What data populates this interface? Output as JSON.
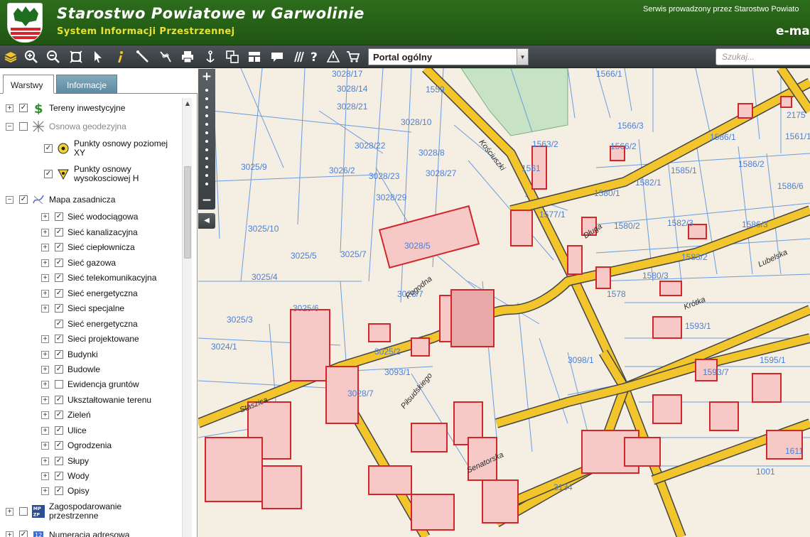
{
  "header": {
    "title": "Starostwo Powiatowe w Garwolinie",
    "subtitle": "System Informacji Przestrzennej",
    "service_text": "Serwis prowadzony przez Starostwo Powiato",
    "brand": "e-ma",
    "colors": {
      "bar": "#2d6d1c",
      "subtitle": "#e9e230"
    }
  },
  "toolbar": {
    "tools": [
      "layers-icon",
      "zoom-in-icon",
      "zoom-out-icon",
      "zoom-extent-icon",
      "pointer-icon",
      "info-icon",
      "measure-distance-icon",
      "measure-path-icon",
      "print-icon",
      "anchor-icon",
      "copy-icon",
      "layout-icon",
      "comment-icon",
      "hatch-icon",
      "help-icon",
      "warning-icon",
      "cart-icon"
    ],
    "portal_value": "Portal ogólny",
    "search_placeholder": "Szukaj..."
  },
  "panel": {
    "tabs": [
      "Warstwy",
      "Informacje"
    ],
    "layers": [
      {
        "label": "Tereny inwestycyjne",
        "level": 0,
        "checked": true,
        "expand": "+",
        "icon": "dollar-icon"
      },
      {
        "label": "Osnowa geodezyjna",
        "level": 0,
        "checked": false,
        "expand": "−",
        "icon": "survey-grid-icon",
        "muted": true
      },
      {
        "label": "Punkty osnowy poziomej XY",
        "level": 1,
        "checked": true,
        "icon": "horizontal-control-point-icon"
      },
      {
        "label": "Punkty osnowy wysokosciowej H",
        "level": 1,
        "checked": true,
        "icon": "vertical-control-point-icon"
      },
      {
        "label": "Mapa zasadnicza",
        "level": 0,
        "checked": true,
        "expand": "−",
        "icon": "base-map-icon"
      },
      {
        "label": "Sieć wodociągowa",
        "level": 1,
        "checked": true,
        "expand": "+"
      },
      {
        "label": "Sieć kanalizacyjna",
        "level": 1,
        "checked": true,
        "expand": "+"
      },
      {
        "label": "Sieć ciepłownicza",
        "level": 1,
        "checked": true,
        "expand": "+"
      },
      {
        "label": "Sieć gazowa",
        "level": 1,
        "checked": true,
        "expand": "+"
      },
      {
        "label": "Sieć telekomunikacyjna",
        "level": 1,
        "checked": true,
        "expand": "+"
      },
      {
        "label": "Sieć energetyczna",
        "level": 1,
        "checked": true,
        "expand": "+"
      },
      {
        "label": "Sieci specjalne",
        "level": 1,
        "checked": true,
        "expand": "+"
      },
      {
        "label": "Sieć energetyczna",
        "level": 1,
        "checked": true
      },
      {
        "label": "Sieci projektowane",
        "level": 1,
        "checked": true,
        "expand": "+"
      },
      {
        "label": "Budynki",
        "level": 1,
        "checked": true,
        "expand": "+"
      },
      {
        "label": "Budowle",
        "level": 1,
        "checked": true,
        "expand": "+"
      },
      {
        "label": "Ewidencja gruntów",
        "level": 1,
        "checked": false,
        "expand": "+"
      },
      {
        "label": "Ukształtowanie terenu",
        "level": 1,
        "checked": true,
        "expand": "+"
      },
      {
        "label": "Zieleń",
        "level": 1,
        "checked": true,
        "expand": "+"
      },
      {
        "label": "Ulice",
        "level": 1,
        "checked": true,
        "expand": "+"
      },
      {
        "label": "Ogrodzenia",
        "level": 1,
        "checked": true,
        "expand": "+"
      },
      {
        "label": "Słupy",
        "level": 1,
        "checked": true,
        "expand": "+"
      },
      {
        "label": "Wody",
        "level": 1,
        "checked": true,
        "expand": "+"
      },
      {
        "label": "Opisy",
        "level": 1,
        "checked": true,
        "expand": "+"
      },
      {
        "label": "Zagospodarowanie przestrzenne",
        "level": 0,
        "checked": false,
        "expand": "+",
        "icon": "mpzp-icon",
        "icon_text": "MP ZP"
      },
      {
        "label": "Numeracja adresowa",
        "level": 0,
        "checked": true,
        "expand": "+",
        "icon": "address-icon"
      }
    ]
  },
  "map": {
    "parcels": [
      "3028/17",
      "3028/14",
      "3028/21",
      "3028/10",
      "3028/22",
      "3028/8",
      "3026/2",
      "3028/23",
      "3028/27",
      "3025/9",
      "3028/29",
      "3025/10",
      "3025/7",
      "3025/5",
      "3028/5",
      "3025/4",
      "3025/6",
      "3026/7",
      "3025/3",
      "3024/1",
      "3098/1",
      "3093/1",
      "3028/7",
      "1559",
      "1566/1",
      "1566/3",
      "1566/2",
      "1563/2",
      "1561",
      "1580/1",
      "1582/1",
      "1585/1",
      "1577/1",
      "1580/2",
      "1582/3",
      "1586/1",
      "1586/2",
      "1586/6",
      "1586/3",
      "1583/2",
      "1580/3",
      "1578",
      "1593/1",
      "1593/7",
      "1595/1",
      "2175",
      "1561/1",
      "3134",
      "1611",
      "3025/2",
      "1001"
    ],
    "streets": [
      "Kościuszki",
      "Długa",
      "Staszica",
      "Pogodna",
      "Lubelska",
      "Krótka",
      "Senatorska",
      "Piłsudskiego"
    ],
    "colors": {
      "background": "#f4efe2",
      "parcel_line": "#6b9ce0",
      "road": "#f2c52c",
      "building_fill": "#f6c8c6",
      "building_line": "#d2262c",
      "green": "#c8e2c6"
    }
  }
}
